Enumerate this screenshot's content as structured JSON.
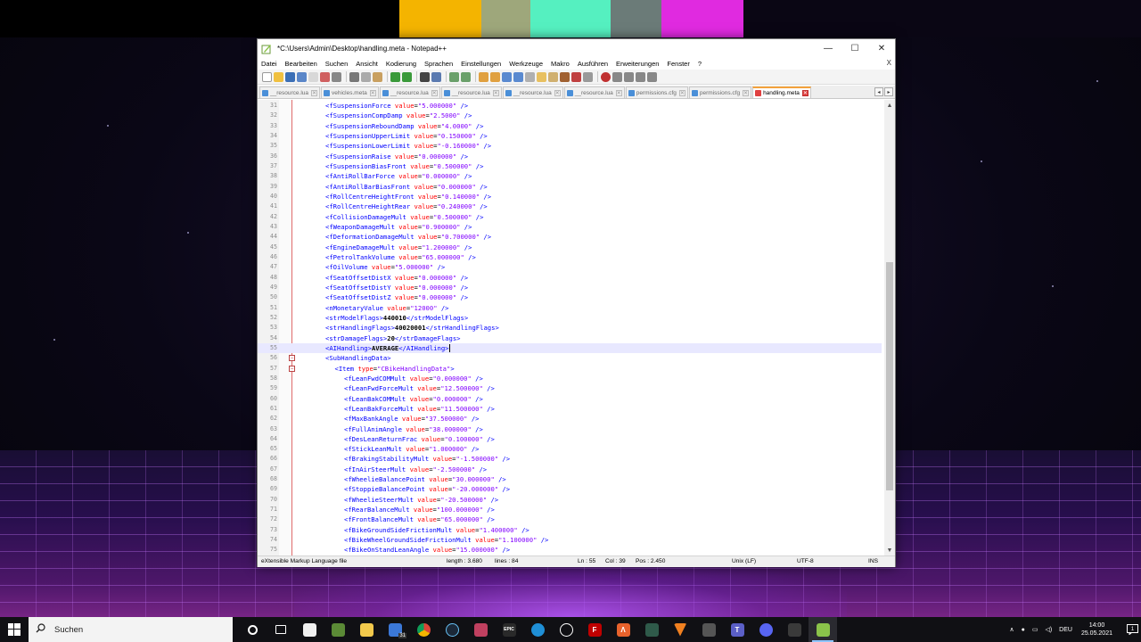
{
  "window": {
    "title": "*C:\\Users\\Admin\\Desktop\\handling.meta - Notepad++",
    "minimize_glyph": "—",
    "maximize_glyph": "☐",
    "close_glyph": "✕"
  },
  "menu": {
    "items": [
      "Datei",
      "Bearbeiten",
      "Suchen",
      "Ansicht",
      "Kodierung",
      "Sprachen",
      "Einstellungen",
      "Werkzeuge",
      "Makro",
      "Ausführen",
      "Erweiterungen",
      "Fenster",
      "?"
    ],
    "close_doc": "X"
  },
  "tabs": [
    {
      "label": "__resource.lua",
      "active": false
    },
    {
      "label": "vehicles.meta",
      "active": false
    },
    {
      "label": "__resource.lua",
      "active": false
    },
    {
      "label": "__resource.lua",
      "active": false
    },
    {
      "label": "__resource.lua",
      "active": false
    },
    {
      "label": "__resource.lua",
      "active": false
    },
    {
      "label": "permissions.cfg",
      "active": false
    },
    {
      "label": "permissions.cfg",
      "active": false
    },
    {
      "label": "handling.meta",
      "active": true
    }
  ],
  "editor": {
    "current_line": 55,
    "lines": [
      {
        "n": "31",
        "indent": 0,
        "tag": "fSuspensionForce",
        "val": "5.000000"
      },
      {
        "n": "32",
        "indent": 0,
        "tag": "fSuspensionCompDamp",
        "val": "2.5000"
      },
      {
        "n": "33",
        "indent": 0,
        "tag": "fSuspensionReboundDamp",
        "val": "4.0000"
      },
      {
        "n": "34",
        "indent": 0,
        "tag": "fSuspensionUpperLimit",
        "val": "0.150000"
      },
      {
        "n": "35",
        "indent": 0,
        "tag": "fSuspensionLowerLimit",
        "val": "-0.160000"
      },
      {
        "n": "36",
        "indent": 0,
        "tag": "fSuspensionRaise",
        "val": "0.000000"
      },
      {
        "n": "37",
        "indent": 0,
        "tag": "fSuspensionBiasFront",
        "val": "0.500000"
      },
      {
        "n": "38",
        "indent": 0,
        "tag": "fAntiRollBarForce",
        "val": "0.000000"
      },
      {
        "n": "39",
        "indent": 0,
        "tag": "fAntiRollBarBiasFront",
        "val": "0.000000"
      },
      {
        "n": "40",
        "indent": 0,
        "tag": "fRollCentreHeightFront",
        "val": "0.140000"
      },
      {
        "n": "41",
        "indent": 0,
        "tag": "fRollCentreHeightRear",
        "val": "0.240000"
      },
      {
        "n": "42",
        "indent": 0,
        "tag": "fCollisionDamageMult",
        "val": "0.500000"
      },
      {
        "n": "43",
        "indent": 0,
        "tag": "fWeaponDamageMult",
        "val": "0.900000"
      },
      {
        "n": "44",
        "indent": 0,
        "tag": "fDeformationDamageMult",
        "val": "0.700000"
      },
      {
        "n": "45",
        "indent": 0,
        "tag": "fEngineDamageMult",
        "val": "1.200000"
      },
      {
        "n": "46",
        "indent": 0,
        "tag": "fPetrolTankVolume",
        "val": "65.000000"
      },
      {
        "n": "47",
        "indent": 0,
        "tag": "fOilVolume",
        "val": "5.000000"
      },
      {
        "n": "48",
        "indent": 0,
        "tag": "fSeatOffsetDistX",
        "val": "0.000000"
      },
      {
        "n": "49",
        "indent": 0,
        "tag": "fSeatOffsetDistY",
        "val": "0.000000"
      },
      {
        "n": "50",
        "indent": 0,
        "tag": "fSeatOffsetDistZ",
        "val": "0.000000"
      },
      {
        "n": "51",
        "indent": 0,
        "tag": "nMonetaryValue",
        "val": "12000"
      },
      {
        "n": "52",
        "indent": 0,
        "text_tag": "strModelFlags",
        "text": "440010"
      },
      {
        "n": "53",
        "indent": 0,
        "text_tag": "strHandlingFlags",
        "text": "40020001"
      },
      {
        "n": "54",
        "indent": 0,
        "text_tag": "strDamageFlags",
        "text": "20"
      },
      {
        "n": "55",
        "indent": 0,
        "text_tag": "AIHandling",
        "text": "AVERAGE",
        "caret": true
      },
      {
        "n": "56",
        "indent": 0,
        "open": "SubHandlingData",
        "fold": true
      },
      {
        "n": "57",
        "indent": 1,
        "open_type": "Item",
        "type_val": "CBikeHandlingData",
        "fold": true
      },
      {
        "n": "58",
        "indent": 2,
        "tag": "fLeanFwdCOMMult",
        "val": "0.000000"
      },
      {
        "n": "59",
        "indent": 2,
        "tag": "fLeanFwdForceMult",
        "val": "12.500000"
      },
      {
        "n": "60",
        "indent": 2,
        "tag": "fLeanBakCOMMult",
        "val": "0.000000"
      },
      {
        "n": "61",
        "indent": 2,
        "tag": "fLeanBakForceMult",
        "val": "11.500000"
      },
      {
        "n": "62",
        "indent": 2,
        "tag": "fMaxBankAngle",
        "val": "37.500000"
      },
      {
        "n": "63",
        "indent": 2,
        "tag": "fFullAnimAngle",
        "val": "38.000000"
      },
      {
        "n": "64",
        "indent": 2,
        "tag": "fDesLeanReturnFrac",
        "val": "0.100000"
      },
      {
        "n": "65",
        "indent": 2,
        "tag": "fStickLeanMult",
        "val": "1.000000"
      },
      {
        "n": "66",
        "indent": 2,
        "tag": "fBrakingStabilityMult",
        "val": "-1.500000"
      },
      {
        "n": "67",
        "indent": 2,
        "tag": "fInAirSteerMult",
        "val": "-2.500000"
      },
      {
        "n": "68",
        "indent": 2,
        "tag": "fWheelieBalancePoint",
        "val": "30.000000"
      },
      {
        "n": "69",
        "indent": 2,
        "tag": "fStoppieBalancePoint",
        "val": "-20.000000"
      },
      {
        "n": "70",
        "indent": 2,
        "tag": "fWheelieSteerMult",
        "val": "-20.500000"
      },
      {
        "n": "71",
        "indent": 2,
        "tag": "fRearBalanceMult",
        "val": "100.000000"
      },
      {
        "n": "72",
        "indent": 2,
        "tag": "fFrontBalanceMult",
        "val": "65.000000"
      },
      {
        "n": "73",
        "indent": 2,
        "tag": "fBikeGroundSideFrictionMult",
        "val": "1.400000"
      },
      {
        "n": "74",
        "indent": 2,
        "tag": "fBikeWheelGroundSideFrictionMult",
        "val": "1.100000"
      },
      {
        "n": "75",
        "indent": 2,
        "tag": "fBikeOnStandLeanAngle",
        "val": "15.000000"
      }
    ]
  },
  "status": {
    "language": "eXtensible Markup Language file",
    "length": "length : 3.680",
    "lines": "lines : 84",
    "ln": "Ln : 55",
    "col": "Col : 39",
    "pos": "Pos : 2.450",
    "eol": "Unix (LF)",
    "encoding": "UTF-8",
    "mode": "INS"
  },
  "taskbar": {
    "search_placeholder": "Suchen",
    "mail_badge": "31",
    "lang": "DEU",
    "time": "14:00",
    "date": "25.05.2021",
    "notification_count": "1"
  },
  "colors": {
    "tag": "#0000ff",
    "attr": "#ff0000",
    "value": "#8000ff",
    "active_tab_accent": "#f3a13b",
    "current_line": "#e8e8ff"
  }
}
